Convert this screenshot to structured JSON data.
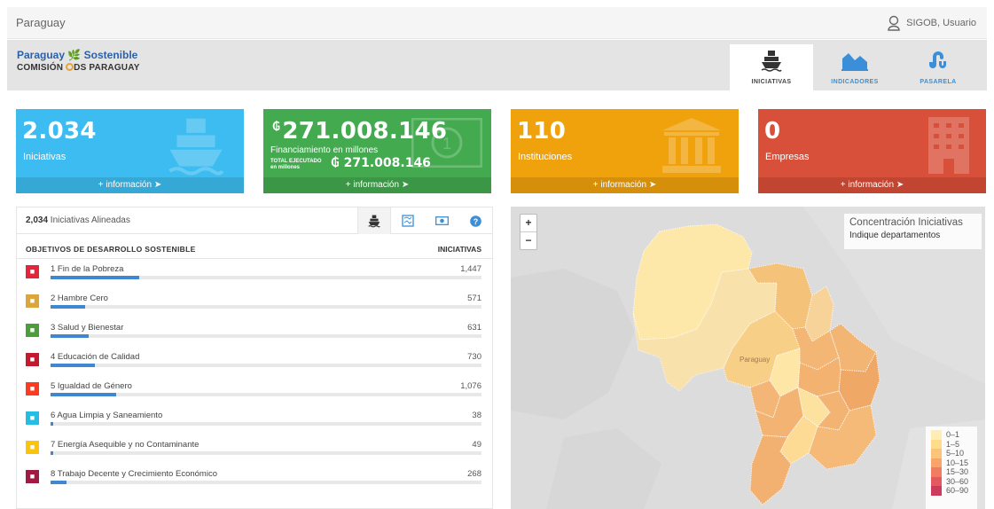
{
  "topbar": {
    "title": "Paraguay",
    "user": "SIGOB, Usuario"
  },
  "brand": {
    "line1_a": "Paraguay",
    "line1_b": "Sostenible",
    "line2_a": "COMISIÓN",
    "line2_b": "DS PARAGUAY"
  },
  "tabs": [
    {
      "label": "INICIATIVAS",
      "icon": "ship-icon",
      "active": true
    },
    {
      "label": "INDICADORES",
      "icon": "area-chart-icon",
      "active": false
    },
    {
      "label": "PASARELA",
      "icon": "stumbleupon-icon",
      "active": false
    }
  ],
  "cards": {
    "iniciativas": {
      "value": "2.034",
      "label": "Iniciativas",
      "more": "+ información",
      "icon": "ship-icon",
      "color": "#3cbcf0"
    },
    "financiamiento": {
      "currency": "₲",
      "value": "271.008.146",
      "label": "Financiamiento en millones",
      "total_label_1": "TOTAL EJECUTADO",
      "total_label_2": "en millones",
      "total_value": "₲ 271.008.146",
      "more": "+ información",
      "icon": "money-icon",
      "color": "#43aa4f"
    },
    "instituciones": {
      "value": "110",
      "label": "Instituciones",
      "more": "+ información",
      "icon": "institution-icon",
      "color": "#f0a20c"
    },
    "empresas": {
      "value": "0",
      "label": "Empresas",
      "more": "+ información",
      "icon": "building-icon",
      "color": "#d9503a"
    }
  },
  "panel": {
    "count": "2,034",
    "count_label": " Iniciativas Alineadas",
    "col_objetivos": "OBJETIVOS DE DESARROLLO SOSTENIBLE",
    "col_iniciativas": "INICIATIVAS",
    "tabs": [
      "ship-icon",
      "map-icon",
      "money-icon",
      "help-icon"
    ],
    "max_value": 1447,
    "rows": [
      {
        "label": "1 Fin de la Pobreza",
        "value": "1,447",
        "n": 1447,
        "color": "#e5243b",
        "icon": "family-icon"
      },
      {
        "label": "2 Hambre Cero",
        "value": "571",
        "n": 571,
        "color": "#dda63a",
        "icon": "bowl-icon"
      },
      {
        "label": "3 Salud y Bienestar",
        "value": "631",
        "n": 631,
        "color": "#4c9f38",
        "icon": "heartbeat-icon"
      },
      {
        "label": "4 Educación de Calidad",
        "value": "730",
        "n": 730,
        "color": "#c5192d",
        "icon": "book-icon"
      },
      {
        "label": "5 Igualdad de Género",
        "value": "1,076",
        "n": 1076,
        "color": "#ff3a21",
        "icon": "gender-icon"
      },
      {
        "label": "6 Agua Limpia y Saneamiento",
        "value": "38",
        "n": 38,
        "color": "#26bde2",
        "icon": "water-icon"
      },
      {
        "label": "7 Energía Asequible y no Contaminante",
        "value": "49",
        "n": 49,
        "color": "#fcc30b",
        "icon": "sun-icon"
      },
      {
        "label": "8 Trabajo Decente y Crecimiento Económico",
        "value": "268",
        "n": 268,
        "color": "#a21942",
        "icon": "growth-icon"
      }
    ]
  },
  "map": {
    "info_title": "Concentración Iniciativas",
    "info_sub": "Indique departamentos",
    "country_label": "Paraguay",
    "legend": [
      {
        "label": "0–1",
        "color": "#ffedb3"
      },
      {
        "label": "1–5",
        "color": "#fddc8b"
      },
      {
        "label": "5–10",
        "color": "#fcc476"
      },
      {
        "label": "10–15",
        "color": "#f9a46a"
      },
      {
        "label": "15–30",
        "color": "#f07c62"
      },
      {
        "label": "30–60",
        "color": "#e25a5e"
      },
      {
        "label": "60–90",
        "color": "#cc3a5e"
      }
    ]
  }
}
